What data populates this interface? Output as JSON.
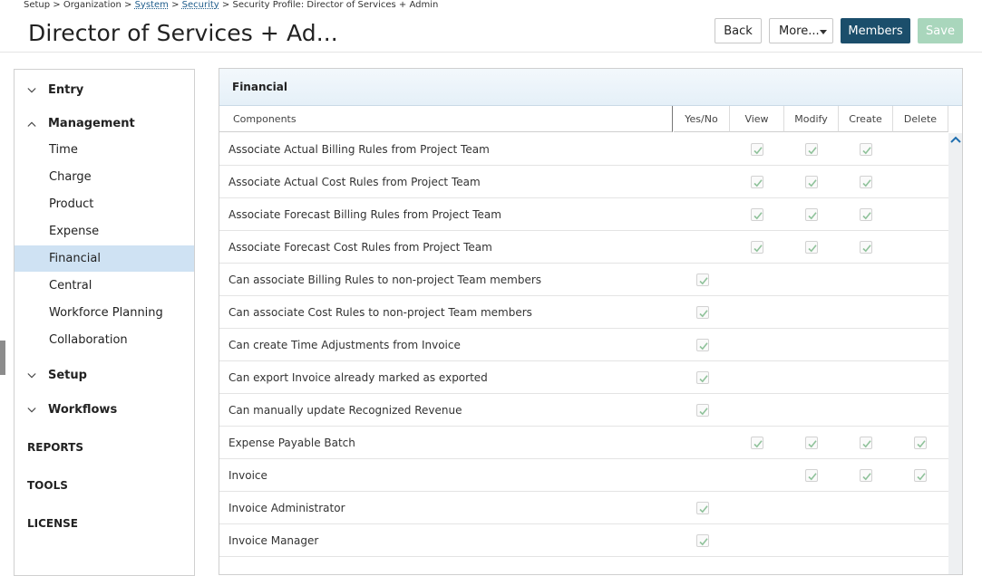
{
  "breadcrumb": {
    "items": [
      "Setup",
      "Organization",
      "System",
      "Security",
      "Security Profile: Director of Services + Admin"
    ],
    "separator": ">"
  },
  "page_title": "Director of Services + Ad...",
  "toolbar": {
    "back_label": "Back",
    "more_label": "More...",
    "members_label": "Members",
    "save_label": "Save"
  },
  "sidebar": {
    "groups": [
      {
        "label": "Entry",
        "expanded": false
      },
      {
        "label": "Management",
        "expanded": true
      },
      {
        "label": "Setup",
        "expanded": false
      },
      {
        "label": "Workflows",
        "expanded": false
      }
    ],
    "management_items": [
      "Time",
      "Charge",
      "Product",
      "Expense",
      "Financial",
      "Central",
      "Workforce Planning",
      "Collaboration"
    ],
    "active_item": "Financial",
    "top_links": [
      "REPORTS",
      "TOOLS",
      "LICENSE"
    ]
  },
  "panel": {
    "title": "Financial",
    "columns": [
      "Components",
      "Yes/No",
      "View",
      "Modify",
      "Create",
      "Delete"
    ],
    "rows": [
      {
        "name": "Associate Actual Billing Rules from Project Team",
        "checks": [
          false,
          true,
          true,
          true,
          false
        ]
      },
      {
        "name": "Associate Actual Cost Rules from Project Team",
        "checks": [
          false,
          true,
          true,
          true,
          false
        ]
      },
      {
        "name": "Associate Forecast Billing Rules from Project Team",
        "checks": [
          false,
          true,
          true,
          true,
          false
        ]
      },
      {
        "name": "Associate Forecast Cost Rules from Project Team",
        "checks": [
          false,
          true,
          true,
          true,
          false
        ]
      },
      {
        "name": "Can associate Billing Rules to non-project Team members",
        "checks": [
          true,
          false,
          false,
          false,
          false
        ]
      },
      {
        "name": "Can associate Cost Rules to non-project Team members",
        "checks": [
          true,
          false,
          false,
          false,
          false
        ]
      },
      {
        "name": "Can create Time Adjustments from Invoice",
        "checks": [
          true,
          false,
          false,
          false,
          false
        ]
      },
      {
        "name": "Can export Invoice already marked as exported",
        "checks": [
          true,
          false,
          false,
          false,
          false
        ]
      },
      {
        "name": "Can manually update Recognized Revenue",
        "checks": [
          true,
          false,
          false,
          false,
          false
        ]
      },
      {
        "name": "Expense Payable Batch",
        "checks": [
          false,
          true,
          true,
          true,
          true
        ]
      },
      {
        "name": "Invoice",
        "checks": [
          false,
          false,
          true,
          true,
          true
        ]
      },
      {
        "name": "Invoice Administrator",
        "checks": [
          true,
          false,
          false,
          false,
          false
        ]
      },
      {
        "name": "Invoice Manager",
        "checks": [
          true,
          false,
          false,
          false,
          false
        ]
      }
    ]
  },
  "colors": {
    "primary": "#1b4e6b",
    "save_disabled": "#a9d6bc",
    "active_nav": "#cfe2f3",
    "check": "#8fc29a"
  },
  "icons": {
    "expand": "chevron-down-icon",
    "collapse": "chevron-up-icon",
    "check": "check-icon",
    "scroll_up": "chevron-up-icon"
  }
}
